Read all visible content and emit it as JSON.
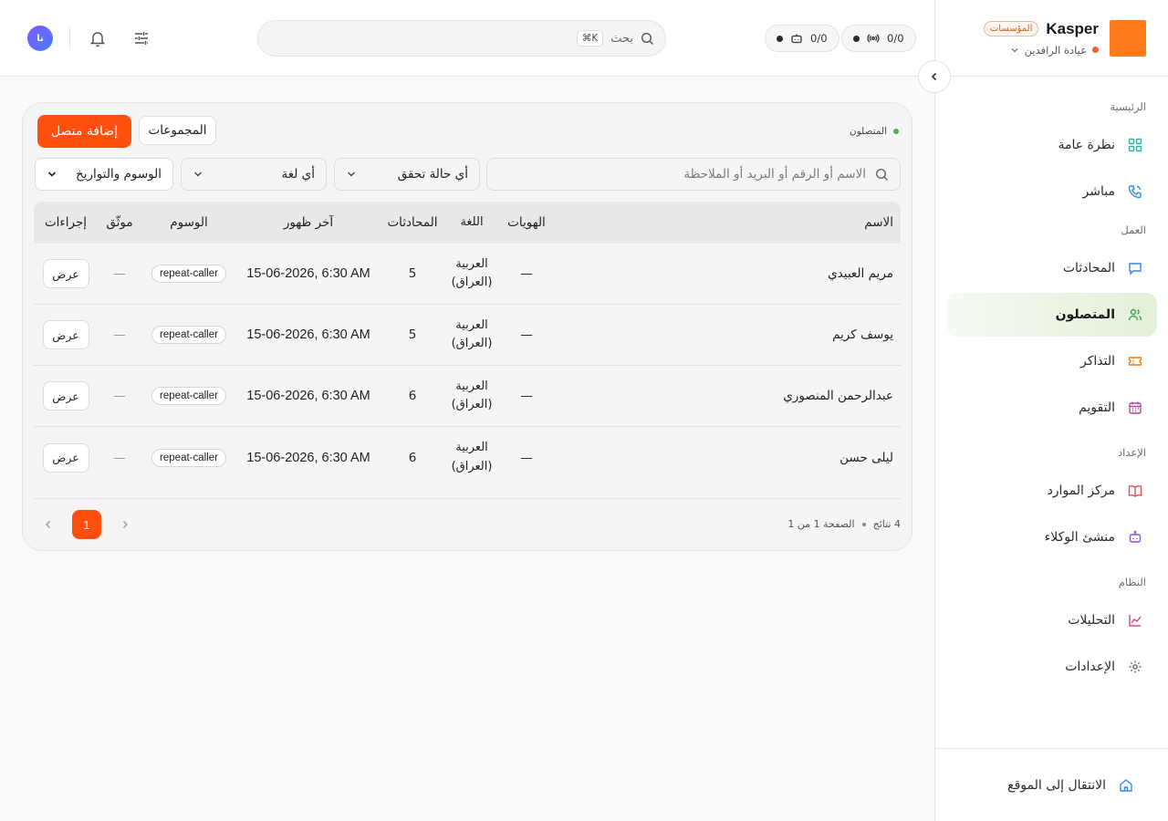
{
  "brand": {
    "name": "Kasper",
    "badge": "المؤسسات",
    "clinic": "عيادة الرافدين"
  },
  "header": {
    "counter_calls": "0/0",
    "counter_agents": "0/0",
    "search_placeholder": "بحث",
    "search_shortcut": "⌘K",
    "avatar_initials": "نا"
  },
  "sidebar": {
    "sections": [
      {
        "label": "الرئيسية",
        "items": [
          {
            "label": "نظرة عامة",
            "icon": "grid-icon"
          },
          {
            "label": "مباشر",
            "icon": "phone-icon"
          }
        ]
      },
      {
        "label": "العمل",
        "items": [
          {
            "label": "المحادثات",
            "icon": "chat-icon"
          },
          {
            "label": "المتصلون",
            "icon": "users-icon",
            "active": true
          },
          {
            "label": "التذاكر",
            "icon": "ticket-icon"
          },
          {
            "label": "التقويم",
            "icon": "calendar-icon"
          }
        ]
      },
      {
        "label": "الإعداد",
        "items": [
          {
            "label": "مركز الموارد",
            "icon": "book-icon"
          },
          {
            "label": "منشئ الوكلاء",
            "icon": "bot-icon"
          }
        ]
      },
      {
        "label": "النظام",
        "items": [
          {
            "label": "التحليلات",
            "icon": "chart-icon"
          },
          {
            "label": "الإعدادات",
            "icon": "gear-icon"
          }
        ]
      }
    ],
    "footer_link": "الانتقال إلى الموقع"
  },
  "page": {
    "crumb": "المتصلون",
    "add_button": "إضافة متصل",
    "groups_button": "المجموعات",
    "filter_search_placeholder": "الاسم أو الرقم أو البريد أو الملاحظة",
    "filter_verification": "أي حالة تحقق",
    "filter_language": "أي لغة",
    "filter_tags": "الوسوم والتواريخ"
  },
  "table": {
    "columns": {
      "name": "الاسم",
      "identities": "الهويات",
      "language": "اللغة",
      "conversations": "المحادثات",
      "last_seen": "آخر ظهور",
      "tags": "الوسوم",
      "verified": "موثّق",
      "actions": "إجراءات"
    },
    "rows": [
      {
        "name": "مريم العبيدي",
        "identities": "—",
        "lang1": "العربية",
        "lang2": "(العراق)",
        "conversations": "5",
        "last_seen": "15-06-2026, 6:30 AM",
        "tag": "repeat-caller",
        "verified": "—",
        "action": "عرض"
      },
      {
        "name": "يوسف كريم",
        "identities": "—",
        "lang1": "العربية",
        "lang2": "(العراق)",
        "conversations": "5",
        "last_seen": "15-06-2026, 6:30 AM",
        "tag": "repeat-caller",
        "verified": "—",
        "action": "عرض"
      },
      {
        "name": "عبدالرحمن المنصوري",
        "identities": "—",
        "lang1": "العربية",
        "lang2": "(العراق)",
        "conversations": "6",
        "last_seen": "15-06-2026, 6:30 AM",
        "tag": "repeat-caller",
        "verified": "—",
        "action": "عرض"
      },
      {
        "name": "ليلى حسن",
        "identities": "—",
        "lang1": "العربية",
        "lang2": "(العراق)",
        "conversations": "6",
        "last_seen": "15-06-2026, 6:30 AM",
        "tag": "repeat-caller",
        "verified": "—",
        "action": "عرض"
      }
    ]
  },
  "pagination": {
    "results": "4 نتائج",
    "page_info": "الصفحة 1 من 1",
    "current": "1"
  },
  "colors": {
    "accent": "#ff4f0f",
    "brand_logo": "#ff7a1a",
    "active_nav": "#e2efd9"
  }
}
